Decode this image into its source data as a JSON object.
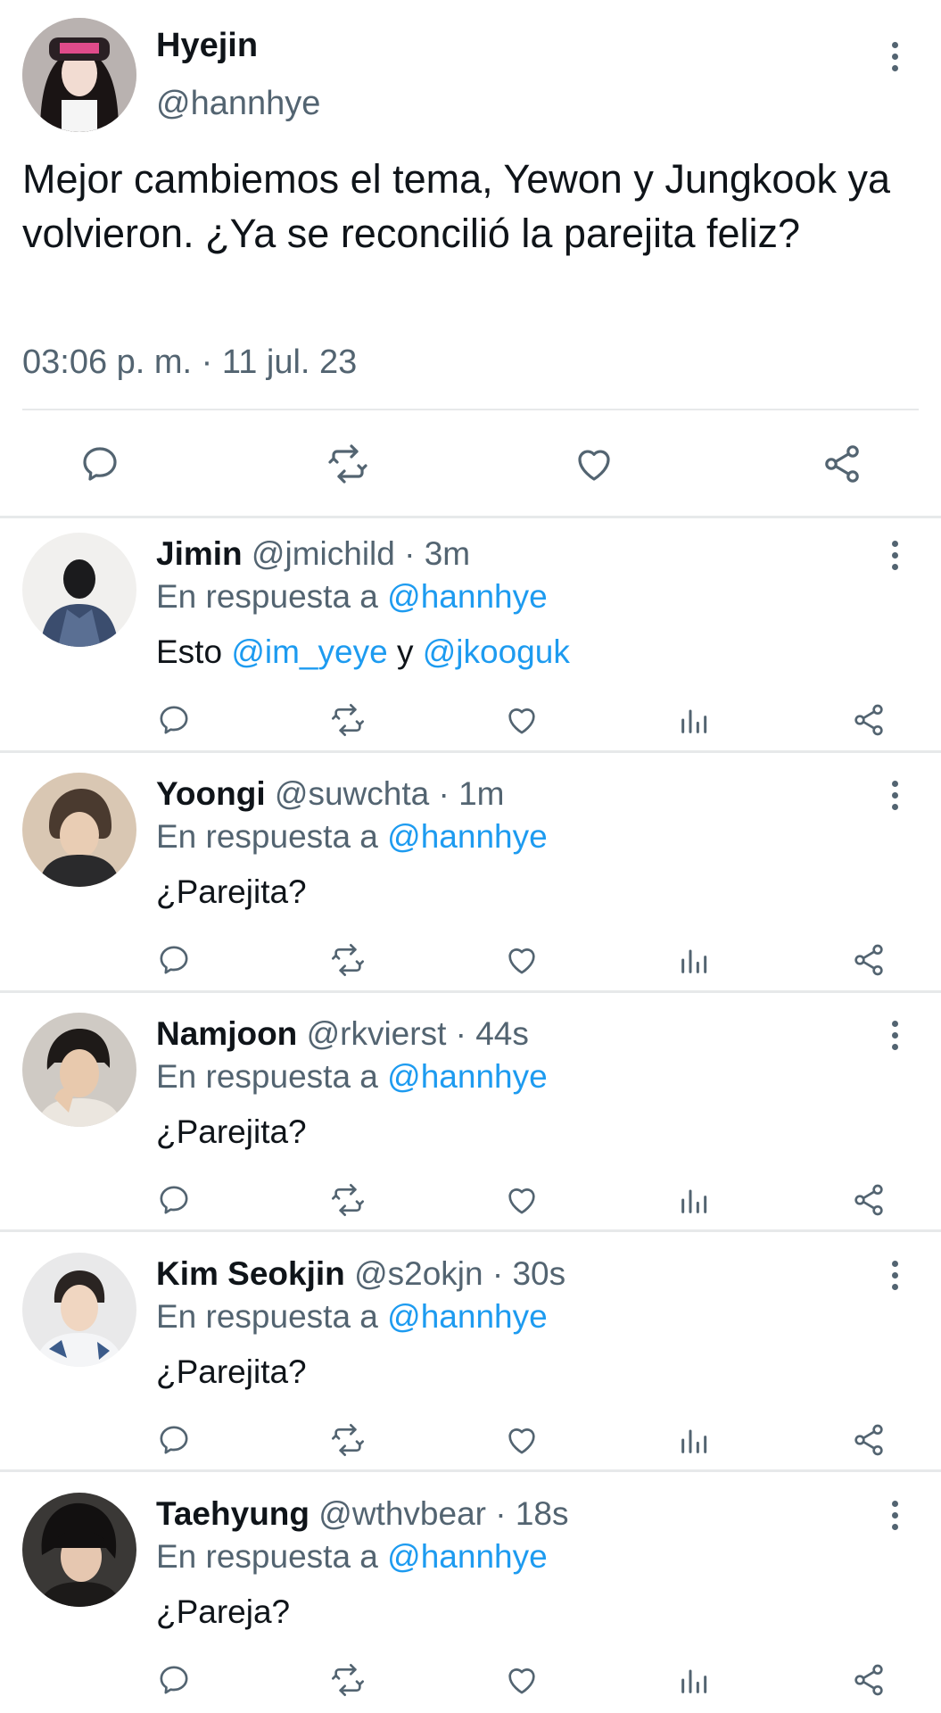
{
  "main_tweet": {
    "name": "Hyejin",
    "handle": "@hannhye",
    "text": "Mejor cambiemos el tema, Yewon y Jungkook ya volvieron. ¿Ya se reconcilió la parejita feliz?",
    "timestamp": "03:06 p. m. · 11 jul. 23",
    "actions": [
      "reply-icon",
      "retweet-icon",
      "like-icon",
      "share-icon"
    ]
  },
  "replies": [
    {
      "name": "Jimin",
      "handle_time": "@jmichild · 3m",
      "replying_prefix": "En respuesta a",
      "replying_to": "@hannhye",
      "body_prefix": "Esto",
      "mention1": "@im_yeye",
      "connector": "y",
      "mention2": "@jkooguk",
      "body": ""
    },
    {
      "name": "Yoongi",
      "handle_time": "@suwchta · 1m",
      "replying_prefix": "En respuesta a",
      "replying_to": "@hannhye",
      "body": "¿Parejita?"
    },
    {
      "name": "Namjoon",
      "handle_time": "@rkvierst · 44s",
      "replying_prefix": "En respuesta a",
      "replying_to": "@hannhye",
      "body": "¿Parejita?"
    },
    {
      "name": "Kim Seokjin",
      "handle_time": "@s2okjn · 30s",
      "replying_prefix": "En respuesta a",
      "replying_to": "@hannhye",
      "body": "¿Parejita?"
    },
    {
      "name": "Taehyung",
      "handle_time": "@wthvbear · 18s",
      "replying_prefix": "En respuesta a",
      "replying_to": "@hannhye",
      "body": "¿Pareja?"
    }
  ],
  "colors": {
    "text": "#0f1419",
    "muted": "#536471",
    "link": "#1d9bf0",
    "divider": "#e7e9ea"
  }
}
